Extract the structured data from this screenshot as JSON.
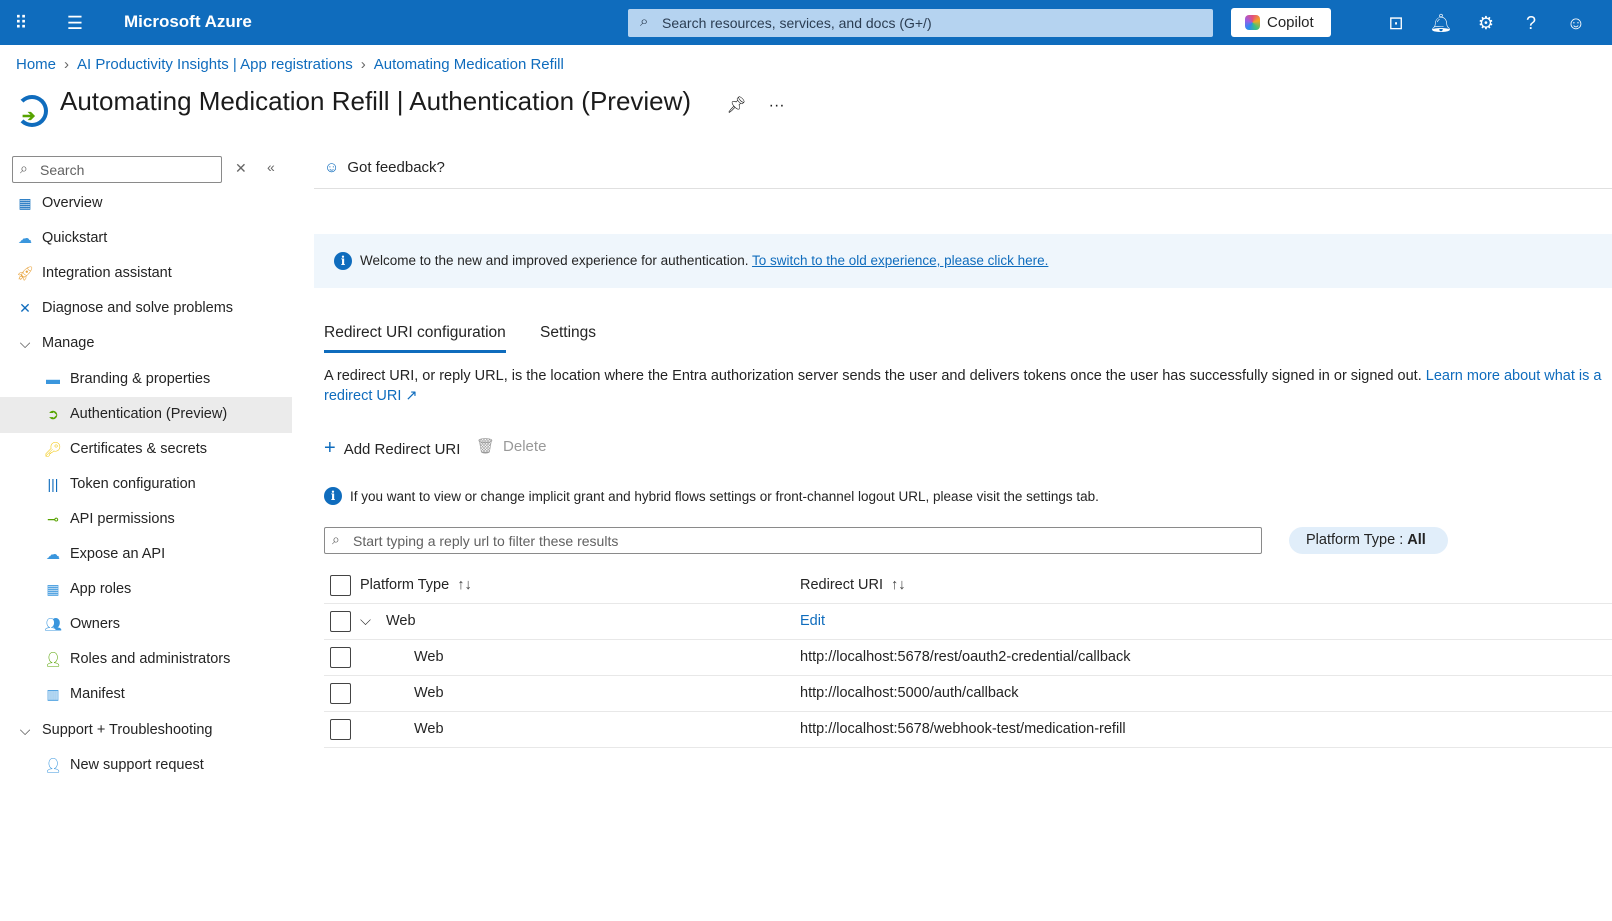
{
  "topbar": {
    "brand": "Microsoft Azure",
    "search_placeholder": "Search resources, services, and docs (G+/)",
    "copilot": "Copilot"
  },
  "breadcrumb": [
    "Home",
    "AI Productivity Insights | App registrations",
    "Automating Medication Refill"
  ],
  "title": {
    "app": "Automating Medication Refill",
    "section": "Authentication (Preview)"
  },
  "sidebar": {
    "search_placeholder": "Search",
    "items": [
      {
        "label": "Overview",
        "icon": "grid-icon",
        "level": 0
      },
      {
        "label": "Quickstart",
        "icon": "cloud-icon",
        "level": 0
      },
      {
        "label": "Integration assistant",
        "icon": "rocket-icon",
        "level": 0
      },
      {
        "label": "Diagnose and solve problems",
        "icon": "wrench-icon",
        "level": 0
      },
      {
        "label": "Manage",
        "icon": "chevron-down-icon",
        "level": 0
      },
      {
        "label": "Branding & properties",
        "icon": "branding-icon",
        "level": 1
      },
      {
        "label": "Authentication (Preview)",
        "icon": "authentication-icon",
        "level": 1
      },
      {
        "label": "Certificates & secrets",
        "icon": "key-icon",
        "level": 1
      },
      {
        "label": "Token configuration",
        "icon": "token-icon",
        "level": 1
      },
      {
        "label": "API permissions",
        "icon": "api-icon",
        "level": 1
      },
      {
        "label": "Expose an API",
        "icon": "cloud-icon",
        "level": 1
      },
      {
        "label": "App roles",
        "icon": "roles-icon",
        "level": 1
      },
      {
        "label": "Owners",
        "icon": "owners-icon",
        "level": 1
      },
      {
        "label": "Roles and administrators",
        "icon": "admin-icon",
        "level": 1
      },
      {
        "label": "Manifest",
        "icon": "manifest-icon",
        "level": 1
      },
      {
        "label": "Support + Troubleshooting",
        "icon": "chevron-down-icon",
        "level": 0
      },
      {
        "label": "New support request",
        "icon": "support-icon",
        "level": 1
      }
    ]
  },
  "main": {
    "feedback": "Got feedback?",
    "banner": {
      "text": "Welcome to the new and improved experience for authentication. ",
      "link": "To switch to the old experience, please click here."
    },
    "tabs": [
      "Redirect URI configuration",
      "Settings"
    ],
    "description": "A redirect URI, or reply URL, is the location where the Entra authorization server sends the user and delivers tokens once the user has successfully signed in or signed out.  ",
    "learn_more": "Learn more about what is a redirect URI",
    "add_label": "Add Redirect URI",
    "delete_label": "Delete",
    "hint": "If you want to view or change implicit grant and hybrid flows settings or front-channel logout URL, please visit the settings tab.",
    "filter_placeholder": "Start typing a reply url to filter these results",
    "pill_label": "Platform Type : ",
    "pill_value": "All",
    "columns": [
      "Platform Type",
      "Redirect URI"
    ],
    "group": {
      "label": "Web",
      "action": "Edit"
    },
    "rows": [
      {
        "type": "Web",
        "uri": "http://localhost:5678/rest/oauth2-credential/callback"
      },
      {
        "type": "Web",
        "uri": "http://localhost:5000/auth/callback"
      },
      {
        "type": "Web",
        "uri": "http://localhost:5678/webhook-test/medication-refill"
      }
    ]
  }
}
